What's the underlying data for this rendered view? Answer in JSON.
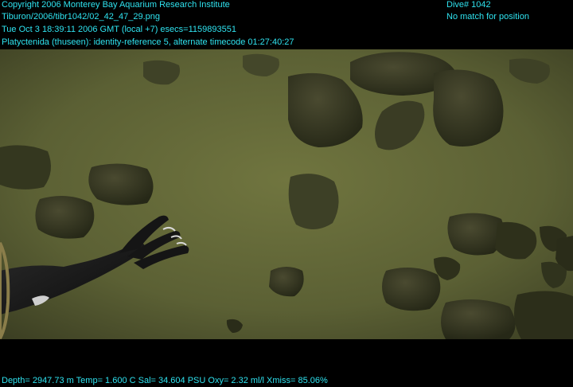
{
  "overlay": {
    "copyright": "Copyright 2006 Monterey Bay Aquarium Research Institute",
    "file_path": "Tiburon/2006/tibr1042/02_42_47_29.png",
    "datetime": "Tue Oct  3 18:39:11 2006 GMT (local +7)  esecs=1159893551",
    "annotation": "Platyctenida (thuseen): identity-reference 5, alternate timecode 01:27:40:27",
    "dive": "Dive# 1042",
    "position_status": "No match for position",
    "telemetry": "Depth= 2947.73 m  Temp= 1.600 C  Sal= 34.604 PSU  Oxy= 2.32 ml/l  Xmiss= 85.06%"
  },
  "colors": {
    "overlay_text": "#2fe3f0",
    "seafloor": "#5a5f35",
    "letterbox": "#000000"
  }
}
